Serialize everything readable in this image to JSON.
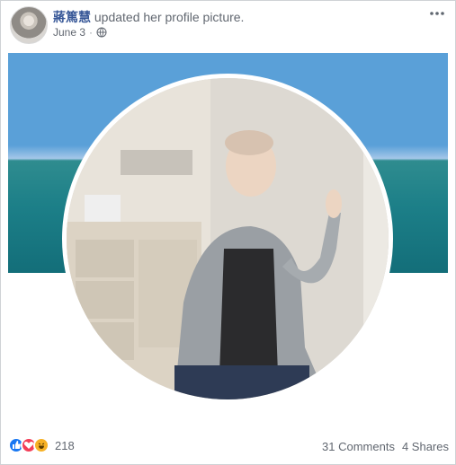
{
  "post": {
    "author": "蔣篤慧",
    "action": "updated her profile picture.",
    "date": "June 3",
    "separator": "·"
  },
  "reactions": {
    "count": "218",
    "types": [
      "like-icon",
      "love-icon",
      "haha-icon"
    ],
    "colors": {
      "like": "#1877f2",
      "love": "#f33e58",
      "haha": "#f7b125"
    }
  },
  "stats": {
    "comments": "31 Comments",
    "shares": "4 Shares"
  },
  "colors": {
    "author": "#385898",
    "meta": "#616770"
  }
}
